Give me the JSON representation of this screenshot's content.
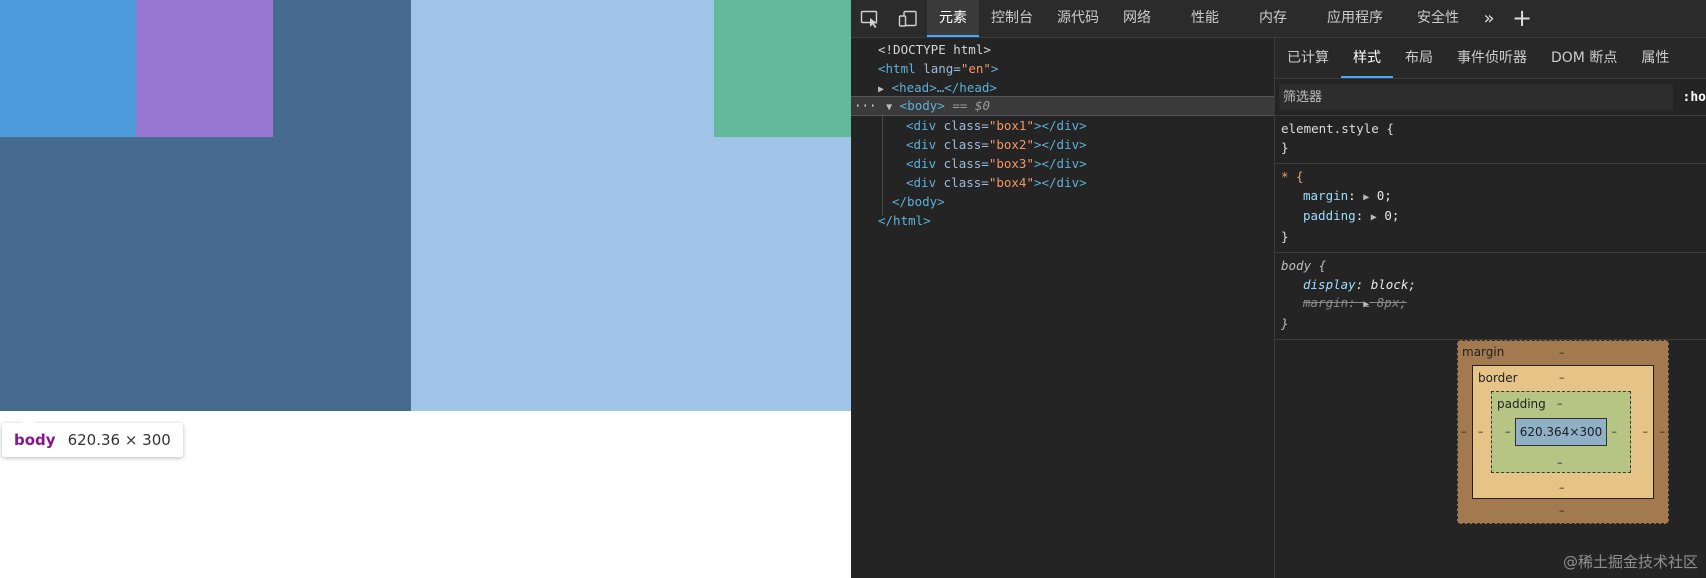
{
  "hover_tooltip": {
    "tag": "body",
    "size": "620.36 × 300"
  },
  "devtools": {
    "toolbar_tabs": [
      {
        "label": "元素",
        "active": true
      },
      {
        "label": "控制台"
      },
      {
        "label": "源代码"
      },
      {
        "label": "网络"
      },
      {
        "label": "性能"
      },
      {
        "label": "内存"
      },
      {
        "label": "应用程序"
      },
      {
        "label": "安全性"
      }
    ],
    "more_tabs_glyph": "»",
    "add_tab_glyph": "+",
    "dom_tree": {
      "doctype": "<!DOCTYPE html>",
      "html_open_tag": "<html",
      "html_attr": "lang",
      "html_attr_value": "\"en\"",
      "html_close_bracket": ">",
      "head_collapsed": "<head>…</head>",
      "body_open": "<body>",
      "body_eq": "== $0",
      "children": [
        {
          "open": "<div",
          "attr": "class",
          "value": "\"box1\"",
          "close": "></div>"
        },
        {
          "open": "<div",
          "attr": "class",
          "value": "\"box2\"",
          "close": "></div>"
        },
        {
          "open": "<div",
          "attr": "class",
          "value": "\"box3\"",
          "close": "></div>"
        },
        {
          "open": "<div",
          "attr": "class",
          "value": "\"box4\"",
          "close": "></div>"
        }
      ],
      "body_close": "</body>",
      "html_close": "</html>"
    },
    "styles_tabs": [
      {
        "label": "已计算"
      },
      {
        "label": "样式",
        "active": true
      },
      {
        "label": "布局"
      },
      {
        "label": "事件侦听器"
      },
      {
        "label": "DOM 断点"
      },
      {
        "label": "属性"
      }
    ],
    "filter_placeholder": "筛选器",
    "hov_label": ":ho",
    "rules": {
      "element_style": {
        "selector": "element.style {",
        "close": "}"
      },
      "universal": {
        "selector": "* {",
        "props": [
          {
            "name": "margin",
            "value": "0;"
          },
          {
            "name": "padding",
            "value": "0;"
          }
        ],
        "close": "}"
      },
      "body_ua": {
        "selector": "body {",
        "props": [
          {
            "name": "display",
            "value": "block;"
          },
          {
            "name": "margin",
            "value": "8px;",
            "struck": true
          }
        ],
        "close": "}"
      }
    },
    "box_model": {
      "margin_label": "margin",
      "border_label": "border",
      "padding_label": "padding",
      "dash": "–",
      "content_size": "620.364×300"
    },
    "watermark": "@稀土掘金技术社区"
  },
  "colors": {
    "body_bg": "#466b8f",
    "box1": "#4e9cdc",
    "box2": "#9878d2",
    "box3": "#9fc4e8",
    "box4": "#62b89a",
    "accent": "#4aa6ff"
  }
}
